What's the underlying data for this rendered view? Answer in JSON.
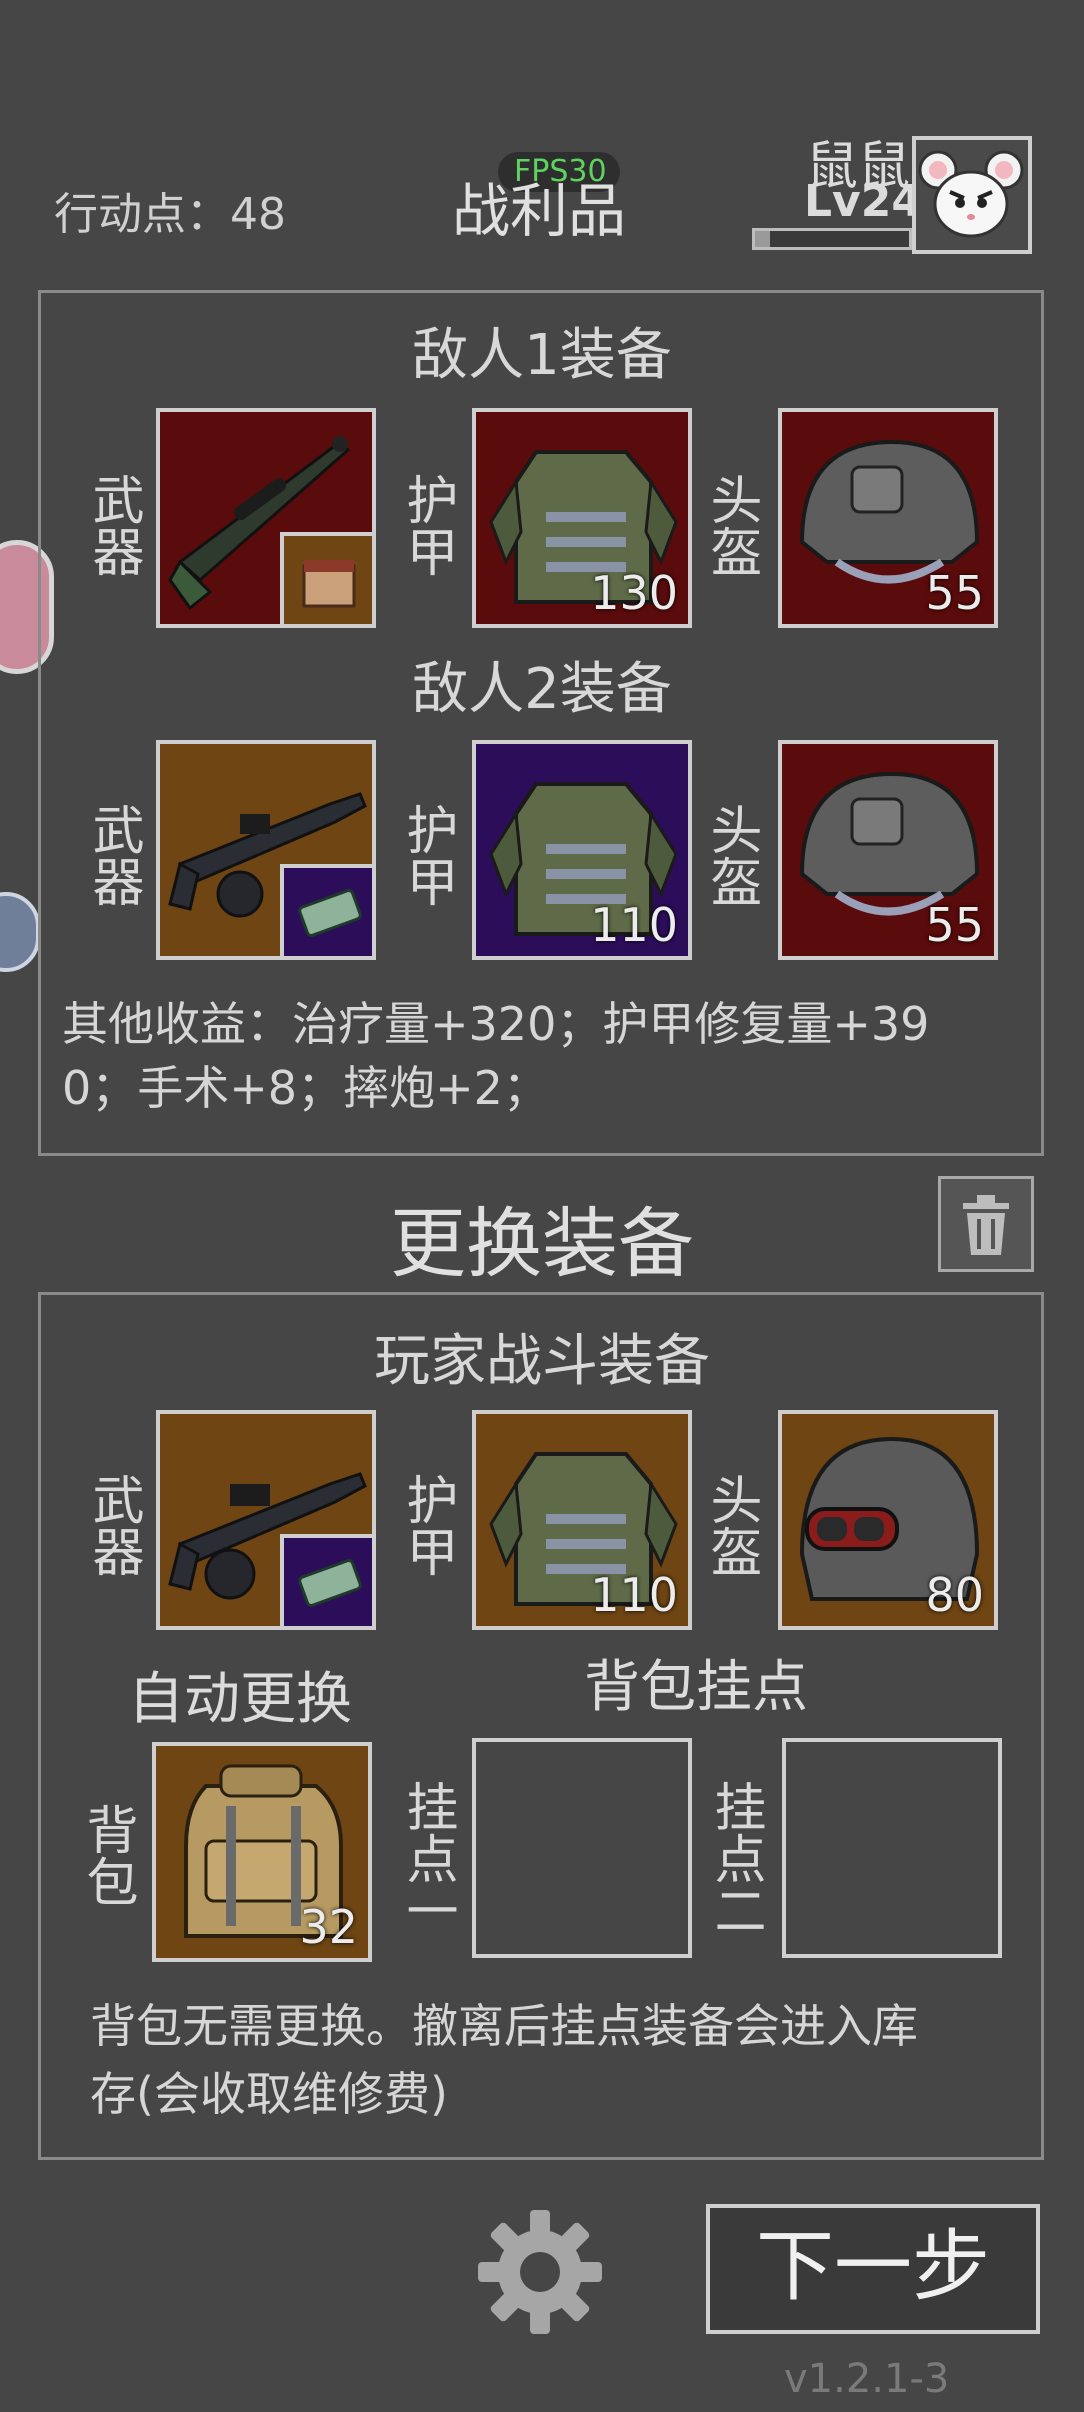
{
  "header": {
    "action_points": "行动点：48",
    "fps": "FPS30",
    "title": "战利品",
    "player_name": "鼠鼠",
    "player_level": "Lv24",
    "level_progress": 0.1
  },
  "loot": {
    "enemy1": {
      "title": "敌人1装备",
      "weapon_label": "武器",
      "armor_label": "护甲",
      "helmet_label": "头盔",
      "armor_value": "130",
      "helmet_value": "55"
    },
    "enemy2": {
      "title": "敌人2装备",
      "weapon_label": "武器",
      "armor_label": "护甲",
      "helmet_label": "头盔",
      "armor_value": "110",
      "helmet_value": "55"
    },
    "other_gains_line1": "其他收益：治疗量+320；护甲修复量+39",
    "other_gains_line2": "0；手术+8；摔炮+2；"
  },
  "change": {
    "title": "更换装备",
    "player_title": "玩家战斗装备",
    "weapon_label": "武器",
    "armor_label": "护甲",
    "helmet_label": "头盔",
    "armor_value": "110",
    "helmet_value": "80",
    "auto_swap": "自动更换",
    "backpack_mounts": "背包挂点",
    "backpack_label": "背包",
    "backpack_value": "32",
    "mount1_label": "挂点一",
    "mount2_label": "挂点二",
    "note_line1": "背包无需更换。撤离后挂点装备会进入库",
    "note_line2": "存(会收取维修费)"
  },
  "footer": {
    "next_button": "下一步",
    "version": "v1.2.1-3"
  },
  "colors": {
    "background": "#464646",
    "slot_red": "#5a0b0b",
    "slot_brown": "#6e4513",
    "slot_purple": "#2c0d5a",
    "fps_green": "#5fd35f"
  }
}
